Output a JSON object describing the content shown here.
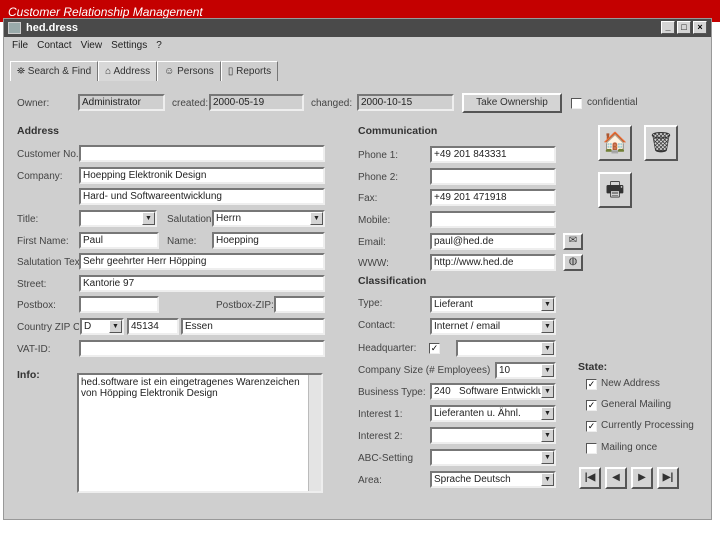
{
  "banner": "Customer Relationship Management",
  "window": {
    "title": "hed.dress"
  },
  "menu": [
    "File",
    "Contact",
    "View",
    "Settings",
    "?"
  ],
  "tabs": [
    "Search & Find",
    "Address",
    "Persons",
    "Reports"
  ],
  "header": {
    "owner_label": "Owner:",
    "owner": "Administrator",
    "created_label": "created:",
    "created": "2000-05-19",
    "changed_label": "changed:",
    "changed": "2000-10-15",
    "take_ownership": "Take Ownership",
    "confidential": "confidential"
  },
  "address": {
    "heading": "Address",
    "customer_no_label": "Customer No.:",
    "customer_no": "",
    "company_label": "Company:",
    "company": "Hoepping Elektronik Design",
    "company2": "Hard- und Softwareentwicklung",
    "title_label": "Title:",
    "title": "",
    "salutation_label": "Salutation:",
    "salutation": "Herrn",
    "first_name_label": "First Name:",
    "first_name": "Paul",
    "name_label": "Name:",
    "name": "Hoepping",
    "salutation_text_label": "Salutation Text",
    "salutation_text": "Sehr geehrter Herr Höpping",
    "street_label": "Street:",
    "street": "Kantorie 97",
    "postbox_label": "Postbox:",
    "postbox": "",
    "postbox_zip_label": "Postbox-ZIP:",
    "postbox_zip": "",
    "country_label": "Country ZIP C.",
    "country": "D",
    "zip": "45134",
    "city": "Essen",
    "vat_label": "VAT-ID:",
    "vat": ""
  },
  "info": {
    "label": "Info:",
    "text": "hed.software ist ein eingetragenes Warenzeichen von Höpping Elektronik Design"
  },
  "communication": {
    "heading": "Communication",
    "phone1_label": "Phone 1:",
    "phone1": "+49 201 843331",
    "phone2_label": "Phone 2:",
    "phone2": "",
    "fax_label": "Fax:",
    "fax": "+49 201 471918",
    "mobile_label": "Mobile:",
    "mobile": "",
    "email_label": "Email:",
    "email": "paul@hed.de",
    "www_label": "WWW:",
    "www": "http://www.hed.de"
  },
  "classification": {
    "heading": "Classification",
    "type_label": "Type:",
    "type": "Lieferant",
    "contact_label": "Contact:",
    "contact": "Internet / email",
    "hq_label": "Headquarter:",
    "hq_value": "",
    "size_label": "Company Size (# Employees)",
    "size": "10",
    "business_label": "Business Type:",
    "business": "240   Software Entwicklu",
    "interest1_label": "Interest 1:",
    "interest1": "Lieferanten u. Ähnl.",
    "interest2_label": "Interest 2:",
    "interest2": "",
    "abc_label": "ABC-Setting",
    "abc": "",
    "area_label": "Area:",
    "area": "Sprache Deutsch"
  },
  "state": {
    "heading": "State:",
    "items": [
      {
        "label": "New Address",
        "checked": true
      },
      {
        "label": "General Mailing",
        "checked": true
      },
      {
        "label": "Currently Processing",
        "checked": true
      },
      {
        "label": "Mailing once",
        "checked": false
      }
    ]
  }
}
